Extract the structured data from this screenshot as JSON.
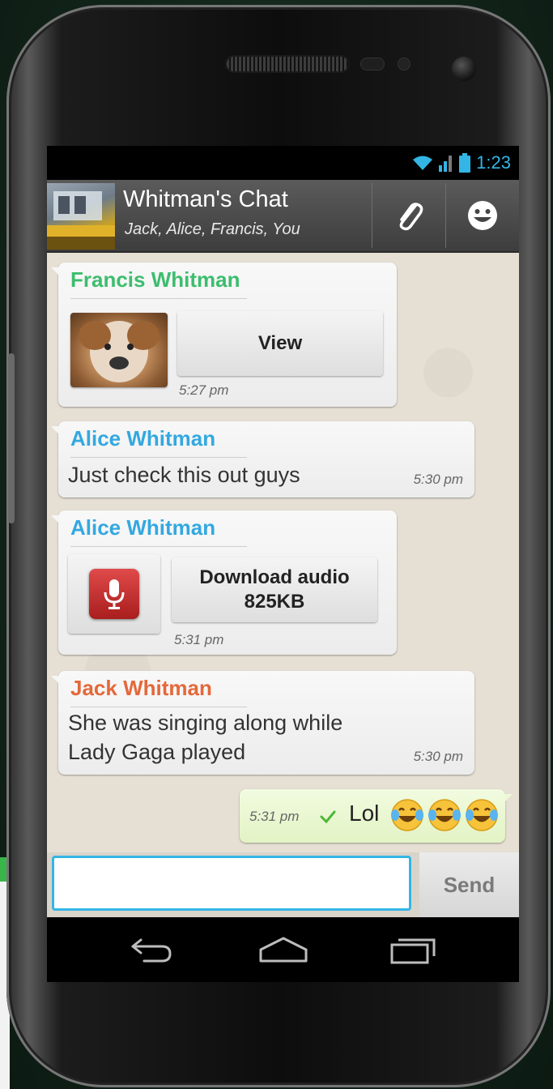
{
  "status_bar": {
    "time": "1:23"
  },
  "header": {
    "title": "Whitman's Chat",
    "subtitle": "Jack, Alice, Francis, You",
    "attach_icon": "paperclip-icon",
    "emoji_icon": "smiley-icon"
  },
  "messages": [
    {
      "sender": "Francis Whitman",
      "sender_color": "#3dbd6e",
      "type": "image",
      "button": "View",
      "time": "5:27 pm"
    },
    {
      "sender": "Alice Whitman",
      "sender_color": "#33a8e0",
      "type": "text",
      "text": "Just check this out guys",
      "time": "5:30 pm"
    },
    {
      "sender": "Alice Whitman",
      "sender_color": "#33a8e0",
      "type": "audio",
      "button_line1": "Download audio",
      "button_line2": "825KB",
      "time": "5:31 pm"
    },
    {
      "sender": "Jack Whitman",
      "sender_color": "#e4683a",
      "type": "text",
      "text_line1": "She was singing along while",
      "text_line2": "Lady Gaga played",
      "time": "5:30 pm"
    },
    {
      "type": "outgoing",
      "time": "5:31 pm",
      "text": "Lol",
      "status": "delivered-check"
    }
  ],
  "composer": {
    "value": "",
    "placeholder": "",
    "send_label": "Send"
  },
  "nav": {
    "back": "back-icon",
    "home": "home-icon",
    "recents": "recents-icon"
  },
  "colors": {
    "accent": "#33b5e5",
    "outgoing_bubble": "#e2f3c4"
  }
}
